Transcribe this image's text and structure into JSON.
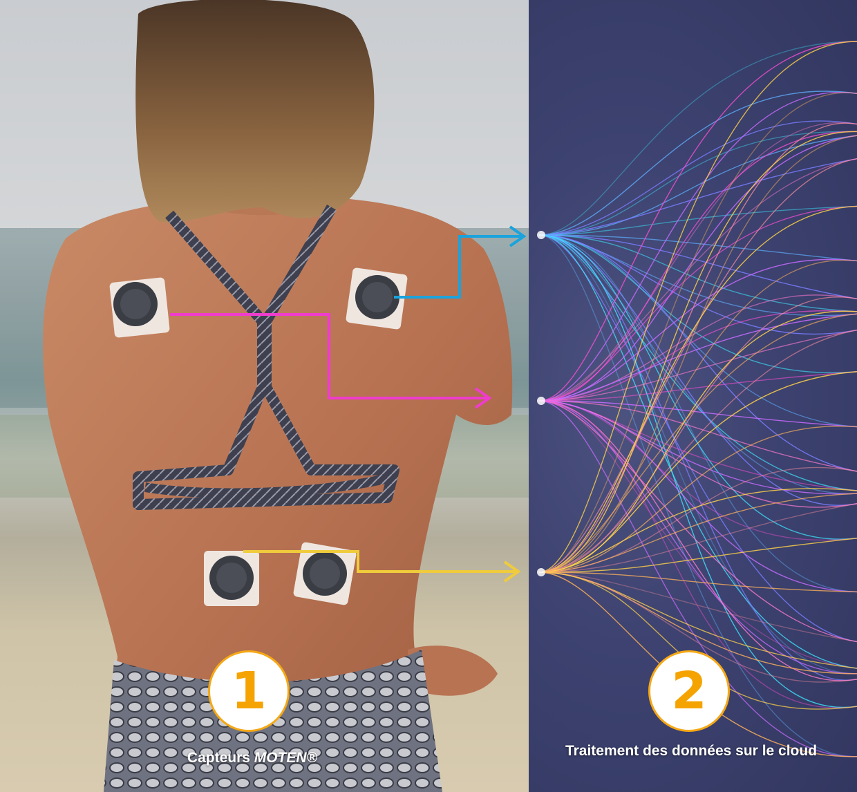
{
  "steps": [
    {
      "number": "1",
      "caption_prefix": "Capteurs ",
      "caption_brand": "MOTEN®"
    },
    {
      "number": "2",
      "caption": "Traitement des données sur le cloud"
    }
  ],
  "sensor_label": "MOTEN",
  "colors": {
    "accent_orange": "#f5a300",
    "arrow_blue": "#1aa3dc",
    "arrow_magenta": "#f03ccd",
    "arrow_yellow": "#f0cc3c",
    "panel_background": "#3d4270"
  }
}
